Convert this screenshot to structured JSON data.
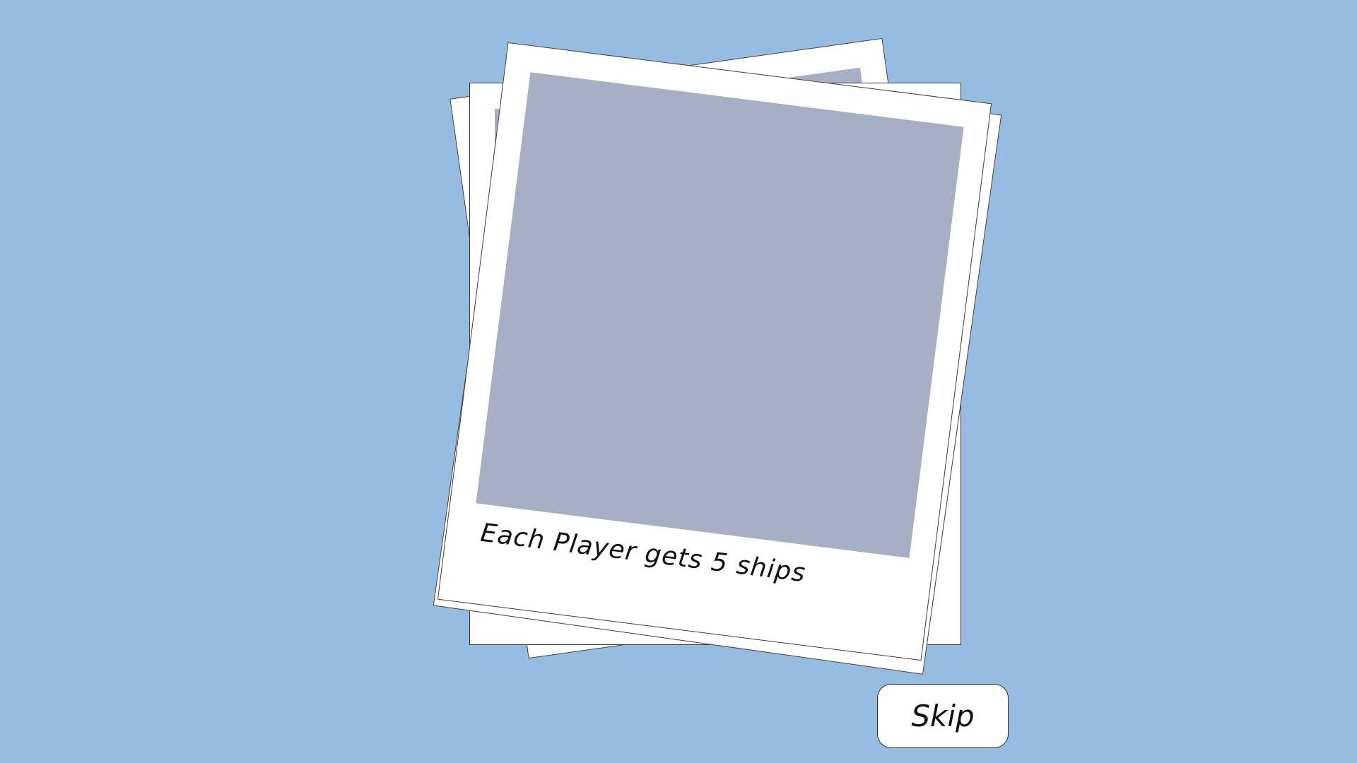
{
  "tutorial": {
    "caption": "Each Player gets 5 ships"
  },
  "controls": {
    "skip_label": "Skip"
  },
  "colors": {
    "background": "#95bce1",
    "photo_placeholder": "#a6afc4",
    "card": "#ffffff"
  }
}
